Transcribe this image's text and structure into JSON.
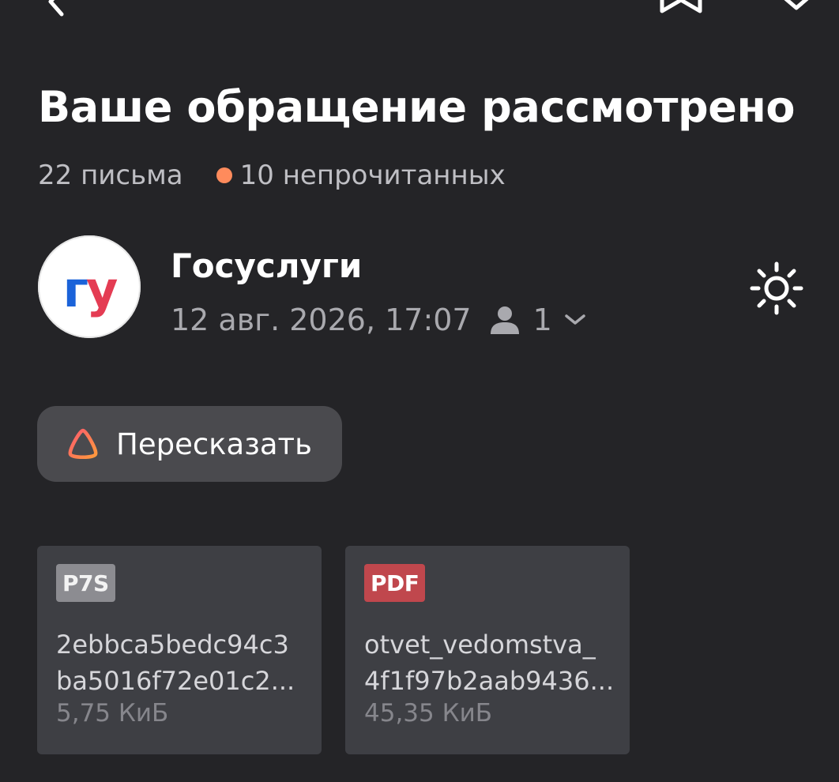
{
  "message": {
    "subject": "Ваше обращение рассмотрено",
    "thread_count": "22 письма",
    "unread_count": "10 непрочитанных",
    "unread_dot_color": "#ff8b5c",
    "sender": {
      "name": "Госуслуги",
      "avatar_text_1": "г",
      "avatar_text_2": "у",
      "date": "12 авг. 2026, 17:07",
      "recipients_count": "1"
    },
    "retell_label": "Пересказать"
  },
  "icons": {
    "back": "chevron-left-icon",
    "theme": "sun-icon",
    "person": "person-icon",
    "expand": "chevron-down-icon",
    "alice": "alice-icon"
  },
  "attachments": [
    {
      "type": "P7S",
      "name_line1": "2ebbca5bedc94c3",
      "name_line2": "ba5016f72e01c2...",
      "size": "5,75 КиБ",
      "badge_color": "#8c8c91"
    },
    {
      "type": "PDF",
      "name_line1": "otvet_vedomstva_",
      "name_line2": "4f1f97b2aab9436...",
      "size": "45,35 КиБ",
      "badge_color": "#c0474d"
    }
  ]
}
